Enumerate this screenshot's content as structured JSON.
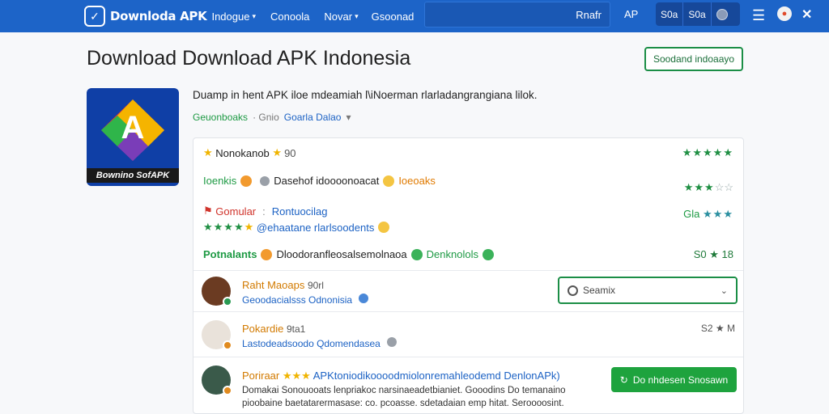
{
  "nav": {
    "brand": "Downloda APK",
    "links": [
      {
        "label": "Indogue",
        "caret": "▾"
      },
      {
        "label": "Conoola"
      },
      {
        "label": "Novar",
        "caret": "▾"
      },
      {
        "label": "Gsoonad"
      }
    ],
    "search_value": "Rnafr",
    "ap": "AP",
    "pills": [
      "S0a",
      "S0a"
    ],
    "icons": [
      "hamburger-icon",
      "avatar-icon",
      "close-icon"
    ]
  },
  "page": {
    "title": "Download Download APK Indonesia",
    "top_button": "Soodand indoaayo"
  },
  "app": {
    "icon_label": "Bownino SofAPK",
    "description": "Duamp in hent APK iloe mdeamiah l\\iNoerman rlarladangrangiana lilok.",
    "meta_green": "Geuonboaks",
    "meta_gray": "· Gnio",
    "meta_blue": "Goarla Dalao",
    "meta_caret": "▾"
  },
  "card": {
    "rows": [
      {
        "lead": "Nonokanob",
        "tail": "90",
        "right_stars": "★★★★★"
      },
      {
        "lead": "Ioenkis",
        "middle": "Dasehof idoooonoacat",
        "tail": "Ioeoaks",
        "right_stars": "★★★",
        "right_extra": "☆☆"
      },
      {
        "lead": "Gomular",
        "sep": ":",
        "middle": "Rontuocilag",
        "line2_stars": "★★★★",
        "line2_text": "@ehaatane rlarlsoodents",
        "right_prefix": "Gla",
        "right_stars": "★★★"
      },
      {
        "lead": "Potnalants",
        "middle": "Dloodoranfleosalsemolnaoa",
        "tail": "Denknolols",
        "right": "S0 ★ 18"
      }
    ],
    "users": [
      {
        "name": "Raht Maoaps",
        "name_tail": "90rl",
        "sub": "Geoodacialsss Odnonisia",
        "right_search": "Seamix"
      },
      {
        "name": "Pokardie",
        "name_tail": "9ta1",
        "sub": "Lastodeadsoodo Qdomendasea",
        "right": "S2 ★ M"
      },
      {
        "name": "Poriraar",
        "name_tail": "★★★",
        "headline": "APKtoniodikoooodmiolonremahleodemd DenlonAPk)",
        "body1": "Domakai Sonouooats lenpriakoc narsinaeadetbianiet. Gooodins Do temanaino",
        "body2": "pioobaine baetatarermasase: co. pcoasse. sdetadaian emp hitat. Seroooosint.",
        "button": "Do nhdesen Snosawn"
      }
    ]
  }
}
